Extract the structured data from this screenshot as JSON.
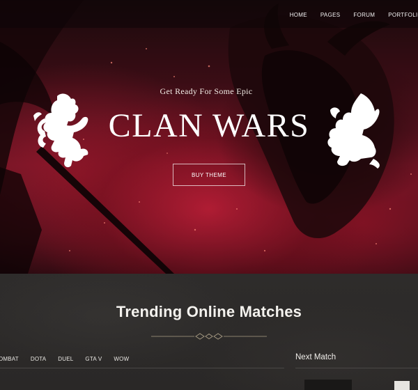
{
  "nav": {
    "items": [
      "HOME",
      "PAGES",
      "FORUM",
      "PORTFOLIO"
    ]
  },
  "hero": {
    "tagline": "Get Ready For Some Epic",
    "title": "CLAN WARS",
    "buy_label": "BUY THEME"
  },
  "section": {
    "title": "Trending Online Matches"
  },
  "tabs": [
    "COMBAT",
    "DOTA",
    "DUEL",
    "GTA V",
    "WOW"
  ],
  "sidebar": {
    "next_match_label": "Next Match"
  },
  "colors": {
    "hero_red": "#8a1a2c",
    "dark_bg": "#2b2928",
    "divider_gold": "#9a8f7a"
  }
}
